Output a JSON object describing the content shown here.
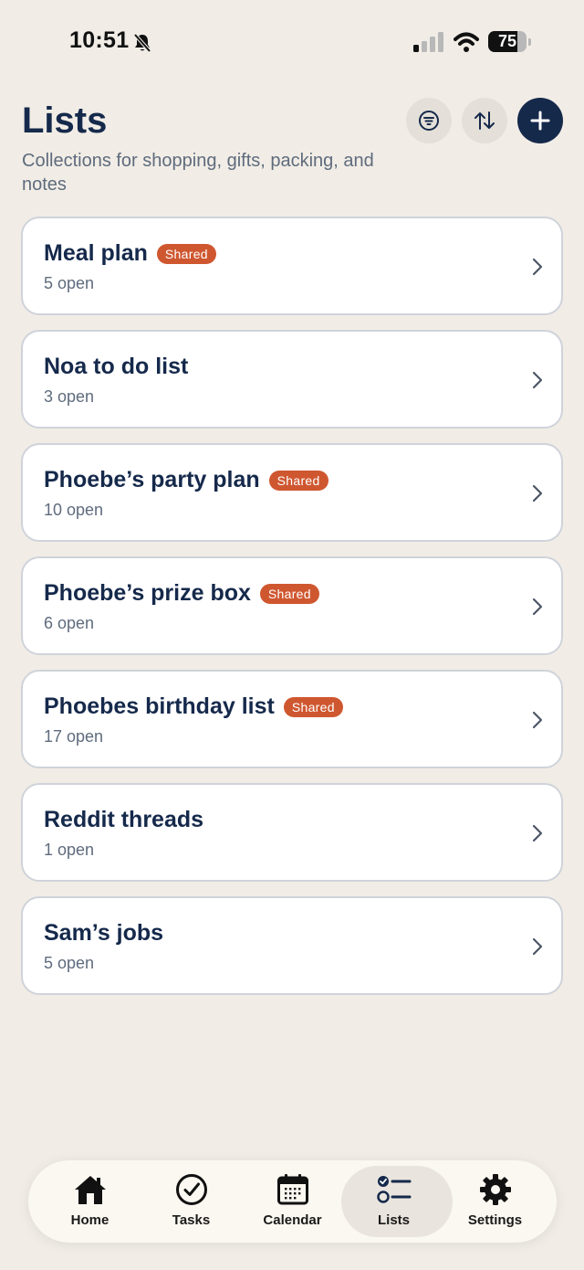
{
  "status_bar": {
    "time": "10:51",
    "battery": "75",
    "battery_level": 0.75
  },
  "header": {
    "title": "Lists",
    "subtitle": "Collections for shopping, gifts, packing, and notes"
  },
  "lists": [
    {
      "title": "Meal plan",
      "badge": "Shared",
      "count": "5 open"
    },
    {
      "title": "Noa to do list",
      "badge": "",
      "count": "3 open"
    },
    {
      "title": "Phoebe’s party plan",
      "badge": "Shared",
      "count": "10 open"
    },
    {
      "title": "Phoebe’s prize box",
      "badge": "Shared",
      "count": "6 open"
    },
    {
      "title": "Phoebes birthday list",
      "badge": "Shared",
      "count": "17 open"
    },
    {
      "title": "Reddit threads",
      "badge": "",
      "count": "1 open"
    },
    {
      "title": "Sam’s jobs",
      "badge": "",
      "count": "5 open"
    }
  ],
  "tabs": [
    {
      "label": "Home",
      "icon": "home-icon"
    },
    {
      "label": "Tasks",
      "icon": "check-circle-icon"
    },
    {
      "label": "Calendar",
      "icon": "calendar-icon"
    },
    {
      "label": "Lists",
      "icon": "list-icon",
      "active": true
    },
    {
      "label": "Settings",
      "icon": "gear-icon"
    }
  ],
  "colors": {
    "background": "#f1ede6",
    "primary": "#15294b",
    "badge": "#cf5730",
    "muted_text": "#5f6b7d"
  }
}
